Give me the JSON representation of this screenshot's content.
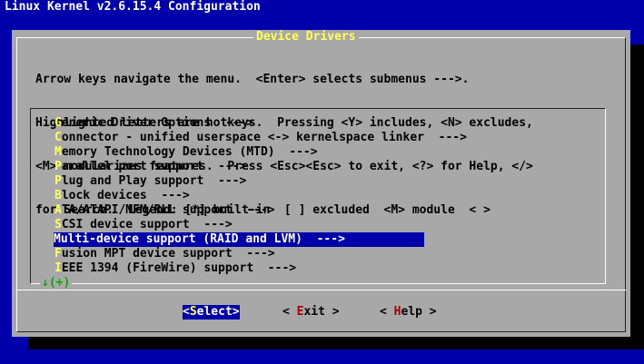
{
  "window": {
    "title": "Linux Kernel v2.6.15.4 Configuration"
  },
  "dialog": {
    "title": "Device Drivers",
    "help_lines": [
      "Arrow keys navigate the menu.  <Enter> selects submenus --->.",
      "Highlighted letters are hotkeys.  Pressing <Y> includes, <N> excludes,",
      "<M> modularizes features.  Press <Esc><Esc> to exit, <?> for Help, </>",
      "for Search.  Legend: [*] built-in  [ ] excluded  <M> module  < >"
    ],
    "menu_items": [
      {
        "hotkey": "G",
        "rest": "eneric Driver Options  --->",
        "selected": false
      },
      {
        "hotkey": "C",
        "rest": "onnector - unified userspace <-> kernelspace linker  --->",
        "selected": false
      },
      {
        "hotkey": "M",
        "rest": "emory Technology Devices (MTD)  --->",
        "selected": false
      },
      {
        "hotkey": "P",
        "rest": "arallel port support  --->",
        "selected": false
      },
      {
        "hotkey": "P",
        "rest": "lug and Play support  --->",
        "selected": false
      },
      {
        "hotkey": "B",
        "rest": "lock devices  --->",
        "selected": false
      },
      {
        "hotkey": "A",
        "rest": "TA/ATAPI/MFM/RLL support  --->",
        "selected": false
      },
      {
        "hotkey": "S",
        "rest": "CSI device support  --->",
        "selected": false
      },
      {
        "hotkey": "M",
        "rest": "ulti-device support (RAID and LVM)  --->",
        "selected": true
      },
      {
        "hotkey": "F",
        "rest": "usion MPT device support  --->",
        "selected": false
      },
      {
        "hotkey": "I",
        "rest": "EEE 1394 (FireWire) support  --->",
        "selected": false
      }
    ],
    "cursor_glyph": "_",
    "more_indicator": "↓(+)",
    "buttons": [
      {
        "pre": "<",
        "hotkey": "S",
        "post": "elect>",
        "active": true
      },
      {
        "pre": "< ",
        "hotkey": "E",
        "post": "xit >",
        "active": false
      },
      {
        "pre": "< ",
        "hotkey": "H",
        "post": "elp >",
        "active": false
      }
    ]
  },
  "colors": {
    "background": "#0000aa",
    "dialog": "#a8a8a8",
    "hotkey": "#ffff55",
    "button_hotkey": "#aa0000",
    "selection": "#0000aa"
  }
}
